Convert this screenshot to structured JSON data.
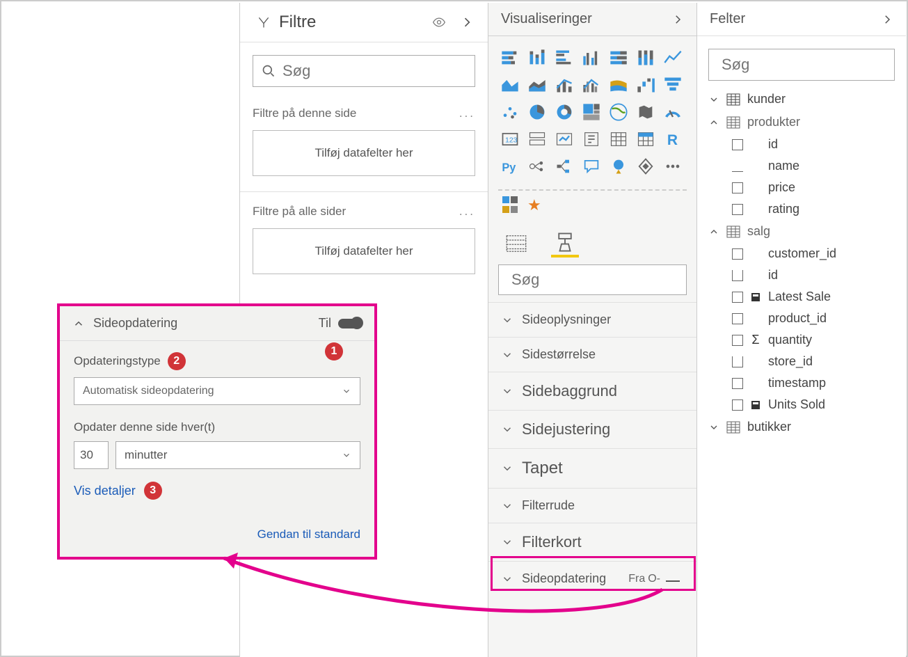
{
  "filters": {
    "title": "Filtre",
    "search_placeholder": "Søg",
    "page_filters_label": "Filtre på denne side",
    "all_pages_label": "Filtre på alle sider",
    "dropzone_text": "Tilføj datafelter her"
  },
  "viz": {
    "title": "Visualiseringer",
    "search_placeholder": "Søg",
    "sections": [
      "Sideoplysninger",
      "Sidestørrelse",
      "Sidebaggrund",
      "Sidejustering",
      "Tapet",
      "Filterrude",
      "Filterkort"
    ],
    "refresh_label": "Sideopdatering",
    "refresh_state": "Fra"
  },
  "fields": {
    "title": "Felter",
    "search_placeholder": "Søg",
    "tables": {
      "kunder": "kunder",
      "produkter": "produkter",
      "salg": "salg",
      "butikker": "butikker"
    },
    "produkter_cols": [
      "id",
      "name",
      "price",
      "rating"
    ],
    "salg_cols": [
      "customer_id",
      "id",
      "Latest Sale",
      "product_id",
      "quantity",
      "store_id",
      "timestamp",
      "Units Sold"
    ]
  },
  "callout": {
    "title": "Sideopdatering",
    "state": "Til",
    "type_label": "Opdateringstype",
    "type_value": "Automatisk sideopdatering",
    "interval_label": "Opdater denne side hver(t)",
    "interval_value": "30",
    "interval_unit": "minutter",
    "details_link": "Vis detaljer",
    "reset_link": "Gendan til standard"
  },
  "badges": {
    "b1": "1",
    "b2": "2",
    "b3": "3"
  }
}
